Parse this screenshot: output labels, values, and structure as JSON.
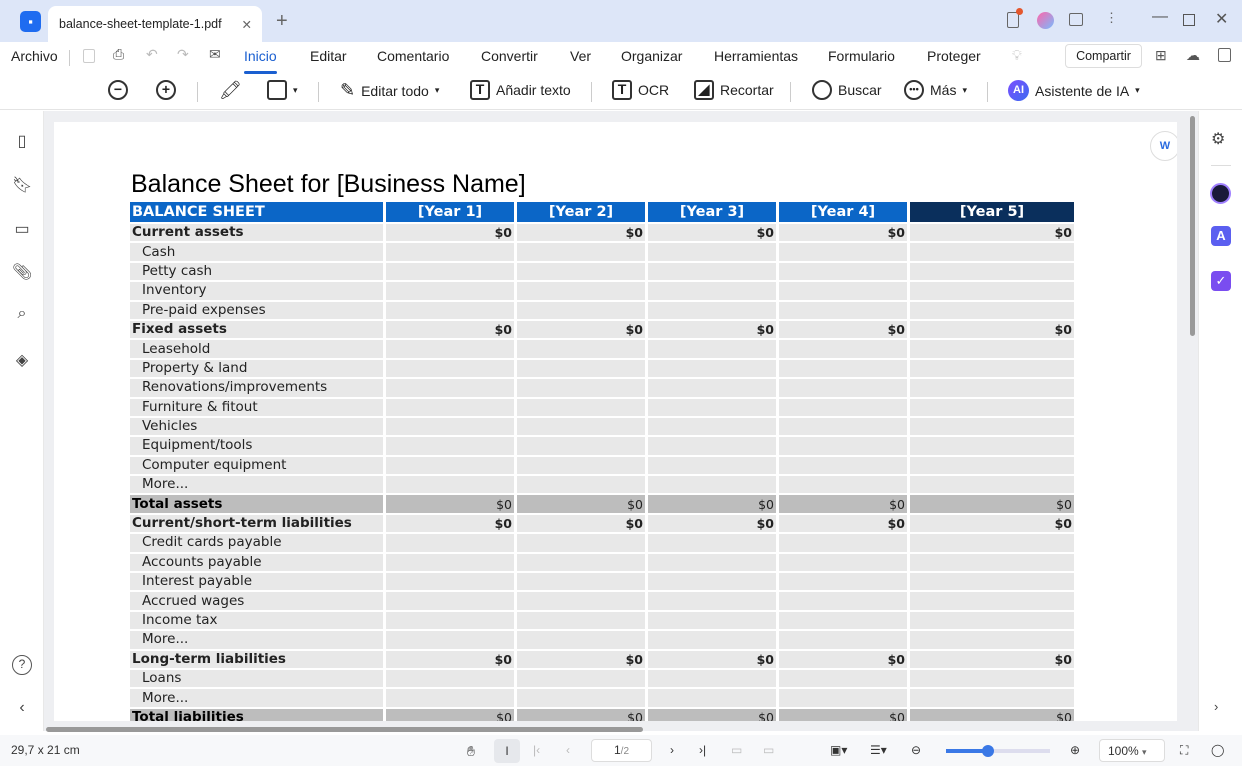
{
  "window": {
    "tab_title": "balance-sheet-template-1.pdf",
    "new_tab": "+"
  },
  "menu": {
    "file": "Archivo",
    "items": [
      "Inicio",
      "Editar",
      "Comentario",
      "Convertir",
      "Ver",
      "Organizar",
      "Herramientas",
      "Formulario",
      "Proteger"
    ],
    "active": "Inicio",
    "share": "Compartir"
  },
  "toolbar": {
    "edit_all": "Editar todo",
    "add_text": "Añadir texto",
    "ocr": "OCR",
    "crop": "Recortar",
    "search": "Buscar",
    "more": "Más",
    "ai": "Asistente de IA",
    "ai_badge": "AI"
  },
  "document": {
    "title": "Balance Sheet for [Business Name]",
    "headers": [
      "BALANCE SHEET",
      "[Year 1]",
      "[Year 2]",
      "[Year 3]",
      "[Year 4]",
      "[Year 5]"
    ],
    "rows": [
      {
        "label": "Current assets",
        "type": "bold",
        "values": [
          "$0",
          "$0",
          "$0",
          "$0",
          "$0"
        ]
      },
      {
        "label": "Cash",
        "type": "item"
      },
      {
        "label": "Petty cash",
        "type": "item"
      },
      {
        "label": "Inventory",
        "type": "item"
      },
      {
        "label": "Pre-paid expenses",
        "type": "item"
      },
      {
        "label": "Fixed assets",
        "type": "bold",
        "values": [
          "$0",
          "$0",
          "$0",
          "$0",
          "$0"
        ]
      },
      {
        "label": "Leasehold",
        "type": "item"
      },
      {
        "label": "Property & land",
        "type": "item"
      },
      {
        "label": "Renovations/improvements",
        "type": "item"
      },
      {
        "label": "Furniture & fitout",
        "type": "item"
      },
      {
        "label": "Vehicles",
        "type": "item"
      },
      {
        "label": "Equipment/tools",
        "type": "item"
      },
      {
        "label": "Computer equipment",
        "type": "item"
      },
      {
        "label": "More...",
        "type": "item"
      },
      {
        "label": "Total assets",
        "type": "total",
        "values": [
          "$0",
          "$0",
          "$0",
          "$0",
          "$0"
        ]
      },
      {
        "label": "Current/short-term liabilities",
        "type": "bold",
        "values": [
          "$0",
          "$0",
          "$0",
          "$0",
          "$0"
        ]
      },
      {
        "label": "Credit cards payable",
        "type": "item"
      },
      {
        "label": "Accounts payable",
        "type": "item"
      },
      {
        "label": "Interest payable",
        "type": "item"
      },
      {
        "label": "Accrued wages",
        "type": "item"
      },
      {
        "label": "Income tax",
        "type": "item"
      },
      {
        "label": "More...",
        "type": "item"
      },
      {
        "label": "Long-term liabilities",
        "type": "bold",
        "values": [
          "$0",
          "$0",
          "$0",
          "$0",
          "$0"
        ]
      },
      {
        "label": "Loans",
        "type": "item"
      },
      {
        "label": "More...",
        "type": "item"
      },
      {
        "label": "Total liabilities",
        "type": "total",
        "values": [
          "$0",
          "$0",
          "$0",
          "$0",
          "$0"
        ]
      }
    ]
  },
  "status": {
    "page_size": "29,7 x 21 cm",
    "page": "1",
    "page_total": "/2",
    "zoom": "100%",
    "zoom_level_percent": 100
  },
  "colors": {
    "accent": "#1a5fd0",
    "header_blue": "#0b66c7",
    "header_navy": "#0a2f5c",
    "cell": "#e8e8e8",
    "total": "#bdbdbd"
  }
}
